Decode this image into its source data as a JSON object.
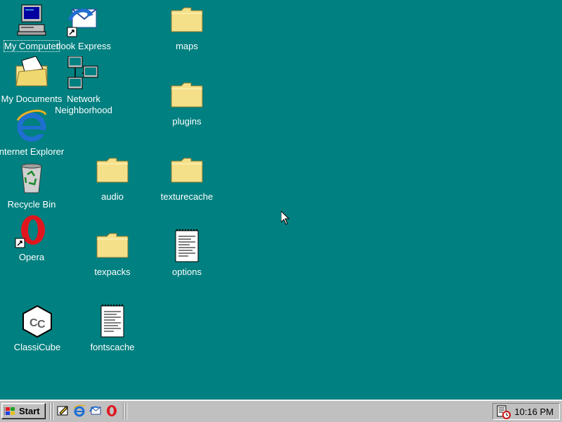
{
  "desktop": {
    "icons": [
      {
        "label": "My Computer",
        "icon": "my-computer-icon"
      },
      {
        "label": "tlook Express",
        "icon": "outlook-express-icon"
      },
      {
        "label": "maps",
        "icon": "folder-icon"
      },
      {
        "label": "My Documents",
        "icon": "my-documents-icon"
      },
      {
        "label": "Network",
        "label2": "Neighborhood",
        "icon": "network-neighborhood-icon"
      },
      {
        "label": "plugins",
        "icon": "folder-icon"
      },
      {
        "label": "nternet Explorer",
        "icon": "internet-explorer-icon"
      },
      {
        "label": "Recycle Bin",
        "icon": "recycle-bin-icon"
      },
      {
        "label": "audio",
        "icon": "folder-icon"
      },
      {
        "label": "texturecache",
        "icon": "folder-icon"
      },
      {
        "label": "Opera",
        "icon": "opera-icon"
      },
      {
        "label": "texpacks",
        "icon": "folder-icon"
      },
      {
        "label": "options",
        "icon": "text-document-icon"
      },
      {
        "label": "ClassiCube",
        "icon": "classicube-icon"
      },
      {
        "label": "fontscache",
        "icon": "text-document-icon"
      }
    ]
  },
  "taskbar": {
    "start_label": "Start",
    "quick_launch": [
      "show-desktop-icon",
      "internet-explorer-icon",
      "outlook-express-icon",
      "opera-icon"
    ],
    "clock": "10:16 PM",
    "tray_icon": "scheduler-icon"
  },
  "colors": {
    "desktop_bg": "#008080",
    "taskbar_bg": "#c0c0c0",
    "folder_yellow": "#f5e08a"
  }
}
